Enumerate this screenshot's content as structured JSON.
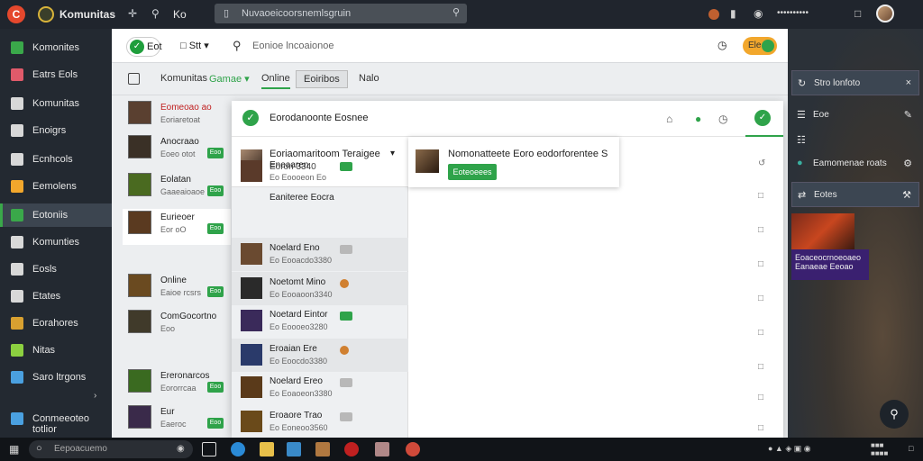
{
  "topbar": {
    "app_title": "Komunitas",
    "search_text": "Nuvaoeicoorsnemlsgruin",
    "nav_icons": [
      "plus-icon",
      "pin-icon"
    ],
    "ko_label": "Ko",
    "right_label": "••••••••••"
  },
  "sidebar": {
    "items": [
      {
        "label": "Komonites",
        "icon": "people-icon",
        "color": "#3aa84a"
      },
      {
        "label": "Eatrs Eols",
        "icon": "food-icon",
        "color": "#e05a6a"
      },
      {
        "label": "Komunitas",
        "icon": "doc-icon",
        "color": "#d8d8d8"
      },
      {
        "label": "Enoigrs",
        "icon": "book-icon",
        "color": "#d8d8d8"
      },
      {
        "label": "Ecnhcols",
        "icon": "list-icon",
        "color": "#d8d8d8"
      },
      {
        "label": "Eemolens",
        "icon": "folder-icon",
        "color": "#f2a72c"
      },
      {
        "label": "Eotoniis",
        "icon": "link-icon",
        "color": "#3aa84a"
      },
      {
        "label": "Komunties",
        "icon": "grid-icon",
        "color": "#d8d8d8"
      },
      {
        "label": "Eosls",
        "icon": "pen-icon",
        "color": "#d8d8d8"
      },
      {
        "label": "Etates",
        "icon": "gear-icon",
        "color": "#d8d8d8"
      },
      {
        "label": "Eorahores",
        "icon": "coin-icon",
        "color": "#d8a030"
      },
      {
        "label": "Nitas",
        "icon": "chart-icon",
        "color": "#8cd040"
      },
      {
        "label": "Saro ltrgons",
        "icon": "chat-icon",
        "color": "#4aa0e0"
      },
      {
        "label": "Conmeeoteo totlior",
        "icon": "window-icon",
        "color": "#4aa0e0"
      }
    ]
  },
  "toolbar": {
    "get_label": "Eot",
    "status_label": "Stt",
    "search_placeholder": "Eonioe lncoaionoe",
    "pill_label": "Ele"
  },
  "tabs": {
    "items": [
      "Komunitas",
      "Gamae",
      "Online",
      "Eoiribos",
      "Nalo"
    ]
  },
  "friends": [
    {
      "name": "Eomeoao ao",
      "status": "Eoriaretoat",
      "badge": "",
      "color": "#c02020"
    },
    {
      "name": "Anocraao",
      "status": "Eoeo otot",
      "badge": "Eoo",
      "color": "#222"
    },
    {
      "name": "Eolatan",
      "status": "Gaaeaioaoe",
      "badge": "Eoo",
      "color": "#222"
    },
    {
      "name": "Eurieoer",
      "status": "Eor oO",
      "badge": "Eoo",
      "color": "#222"
    },
    {
      "name": "Online",
      "status": "Eaioe rcsrs",
      "badge": "Eoo",
      "color": "#222"
    },
    {
      "name": "ComGocortno",
      "status": "Eoo",
      "badge": "",
      "color": "#222"
    },
    {
      "name": "Ereronarcos",
      "status": "Eororrcaa",
      "badge": "Eoo",
      "color": "#222"
    },
    {
      "name": "Eur",
      "status": "Eaeroc",
      "badge": "Eoo",
      "color": "#222"
    }
  ],
  "dialog": {
    "title": "Eorodanoonte Eosnee",
    "top_card": {
      "name": "Eoriaomaritoom Teraigee",
      "sub": "Eoron 3340"
    },
    "popup": {
      "name": "Nomonatteete Eoro eodorforentee S",
      "button": "Eoteoeees"
    },
    "list": [
      {
        "name": "Eneaaren",
        "sub": "Eo Eoooeon Eo",
        "tag": "green",
        "alt": false
      },
      {
        "name": "Eaniteree Eocra",
        "sub": "",
        "tag": "none",
        "alt": false
      },
      {
        "name": "Noelard Eno",
        "sub": "Eo Eooacdo3380",
        "tag": "grey",
        "alt": true
      },
      {
        "name": "Noetomt Mino",
        "sub": "Eo Eooaoon3340",
        "tag": "orange",
        "alt": true
      },
      {
        "name": "Noetard Eintor",
        "sub": "Eo Eoooeo3280",
        "tag": "green",
        "alt": false
      },
      {
        "name": "Eroaian Ere",
        "sub": "Eo Eoocdo3380",
        "tag": "orange",
        "alt": true
      },
      {
        "name": "Noelard Ereo",
        "sub": "Eo Eoaoeon3380",
        "tag": "grey",
        "alt": false
      },
      {
        "name": "Eroaore Trao",
        "sub": "Eo Eoneoo3560",
        "tag": "grey",
        "alt": false
      }
    ]
  },
  "rpanel": {
    "rows": [
      {
        "label": "Stro lonfoto",
        "icon": "refresh-icon",
        "r": "×",
        "hl": true
      },
      {
        "label": "Eoe",
        "icon": "folder-icon",
        "r": "✎",
        "hl": false
      },
      {
        "label": "",
        "icon": "hierarchy-icon",
        "r": "",
        "hl": false
      },
      {
        "label": "Eamomenae roats",
        "icon": "dot-icon",
        "r": "⚙",
        "hl": false
      },
      {
        "label": "Eotes",
        "icon": "swap-icon",
        "r": "⚒",
        "hl": true
      }
    ],
    "game_caption_1": "Eoaceocrnoeoaeo",
    "game_caption_2": "Eanaeae Eeoao"
  },
  "taskbar": {
    "search_placeholder": "Eepoacuemo"
  }
}
